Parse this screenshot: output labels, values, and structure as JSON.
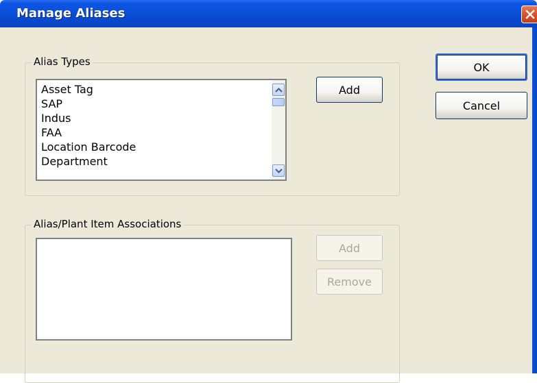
{
  "window": {
    "title": "Manage Aliases",
    "close_icon": "close-icon"
  },
  "alias_types": {
    "group_label": "Alias Types",
    "items": [
      "Asset Tag",
      "SAP",
      "Indus",
      "FAA",
      "Location Barcode",
      "Department"
    ],
    "add_label": "Add"
  },
  "associations": {
    "group_label": "Alias/Plant Item Associations",
    "items": [],
    "add_label": "Add",
    "remove_label": "Remove"
  },
  "buttons": {
    "ok_label": "OK",
    "cancel_label": "Cancel"
  },
  "colors": {
    "titlebar": "#0a4fd8",
    "dialog_bg": "#ece9d8",
    "close_button": "#d6532b"
  }
}
